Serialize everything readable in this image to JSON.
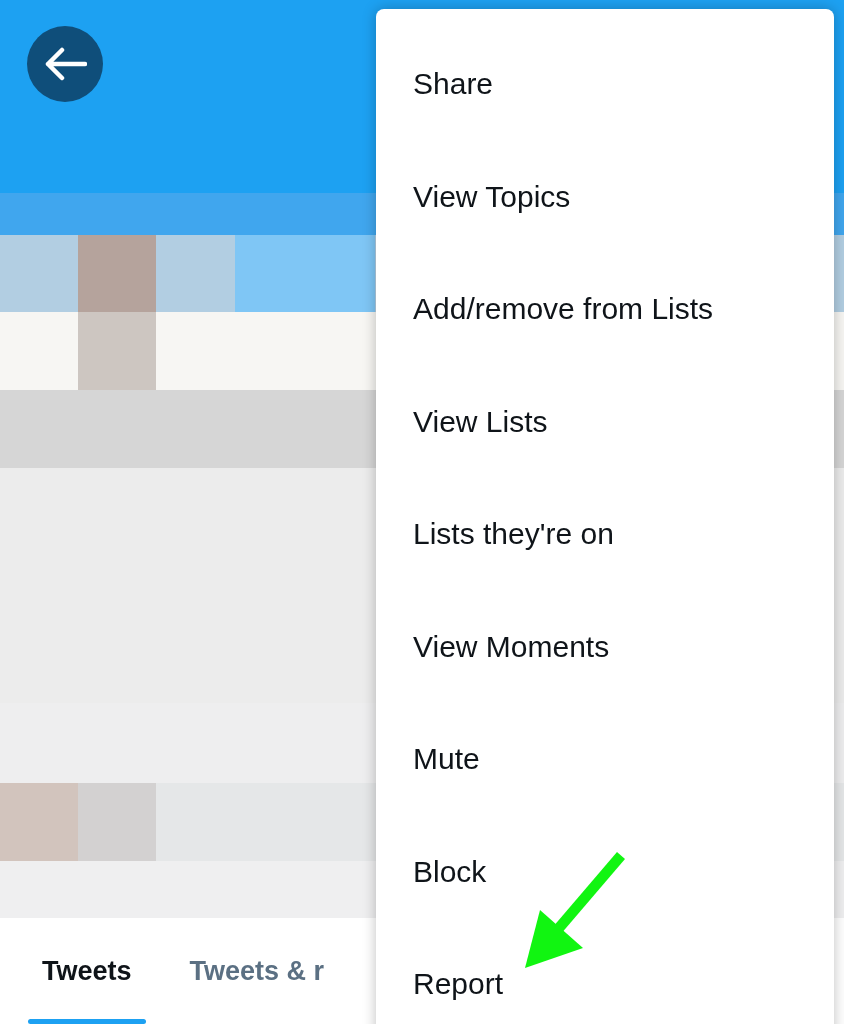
{
  "tabs": [
    {
      "label": "Tweets",
      "selected": true
    },
    {
      "label": "Tweets & r",
      "selected": false
    }
  ],
  "menu": {
    "items": [
      "Share",
      "View Topics",
      "Add/remove from Lists",
      "View Lists",
      "Lists they're on",
      "View Moments",
      "Mute",
      "Block",
      "Report"
    ]
  }
}
